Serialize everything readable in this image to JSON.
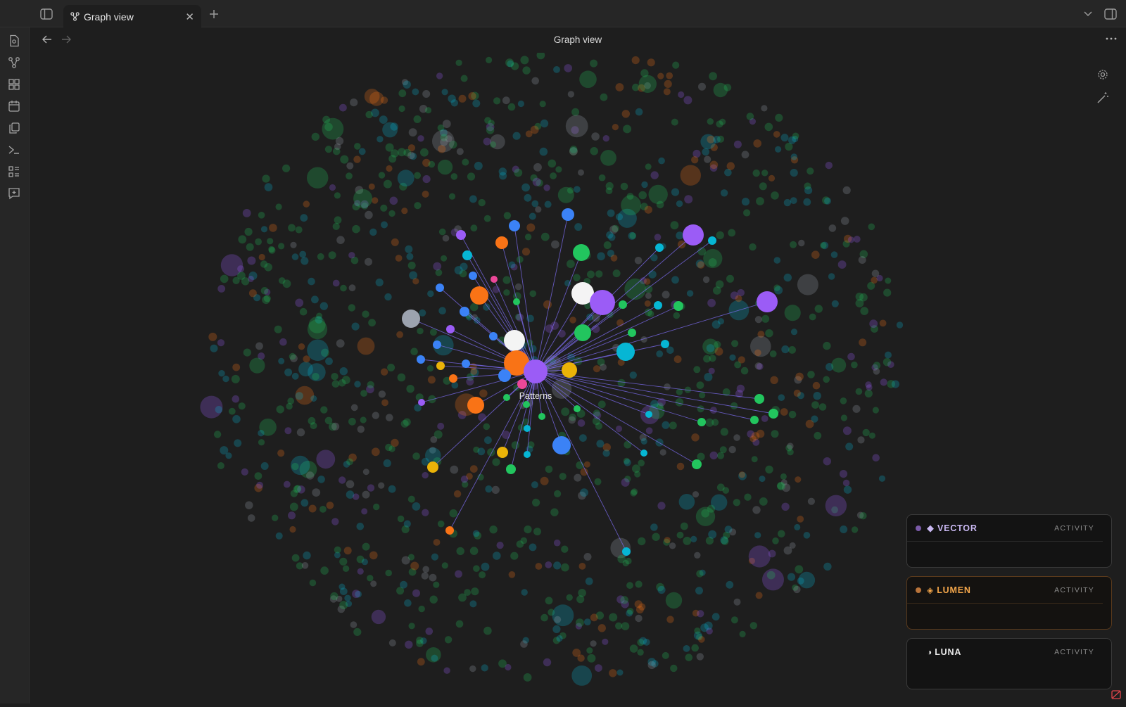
{
  "tabs": [
    {
      "label": "Graph view",
      "icon": "graph-icon"
    }
  ],
  "view": {
    "title": "Graph view",
    "center_node": "Patterns"
  },
  "ribbon": [
    "open-file-icon",
    "graph-icon",
    "canvas-icon",
    "calendar-icon",
    "copy-icon",
    "terminal-icon",
    "list-icon",
    "comment-plus-icon"
  ],
  "panels": [
    {
      "name": "VECTOR",
      "activity": "ACTIVITY",
      "color": "#c27cff",
      "dot": "#7a5aa8"
    },
    {
      "name": "LUMEN",
      "activity": "ACTIVITY",
      "color": "#f2a54a",
      "dot": "#b8733a"
    },
    {
      "name": "LUNA",
      "activity": "ACTIVITY",
      "color": "#e8e8e8",
      "dot": ""
    }
  ],
  "colors": {
    "purple": "#9b5cf6",
    "orange": "#f97316",
    "blue": "#3b82f6",
    "cyan": "#06b6d4",
    "green": "#22c55e",
    "yellow": "#eab308",
    "pink": "#ec4899",
    "white": "#f4f4f4",
    "gray": "#9ca3af",
    "background": "#1e1e1e"
  }
}
